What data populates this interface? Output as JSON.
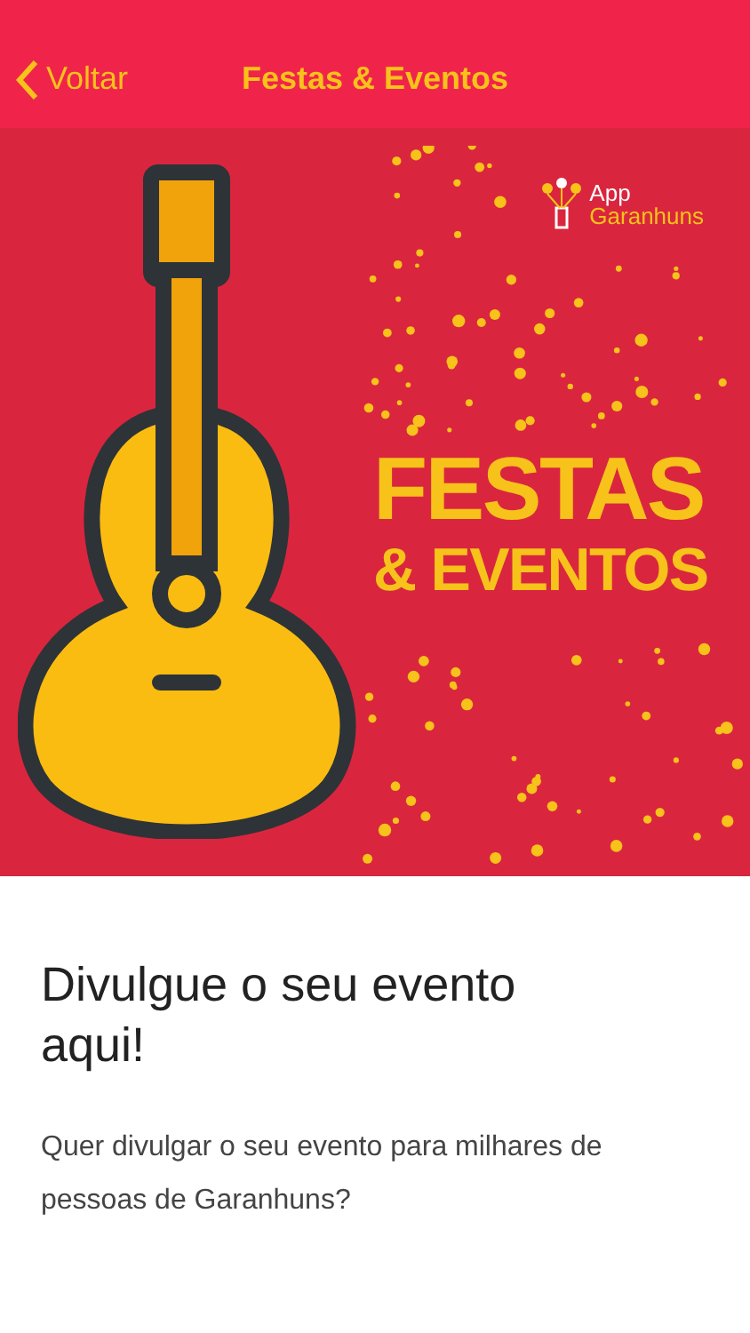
{
  "nav": {
    "back": "Voltar",
    "title": "Festas & Eventos"
  },
  "banner": {
    "logo": [
      "App",
      "Garanhuns"
    ],
    "headline": [
      "FESTAS",
      "& EVENTOS"
    ]
  },
  "article": {
    "heading": "Divulgue o seu evento aqui!",
    "body": "Quer divulgar o seu evento para milhares de pessoas de Garanhuns?"
  }
}
